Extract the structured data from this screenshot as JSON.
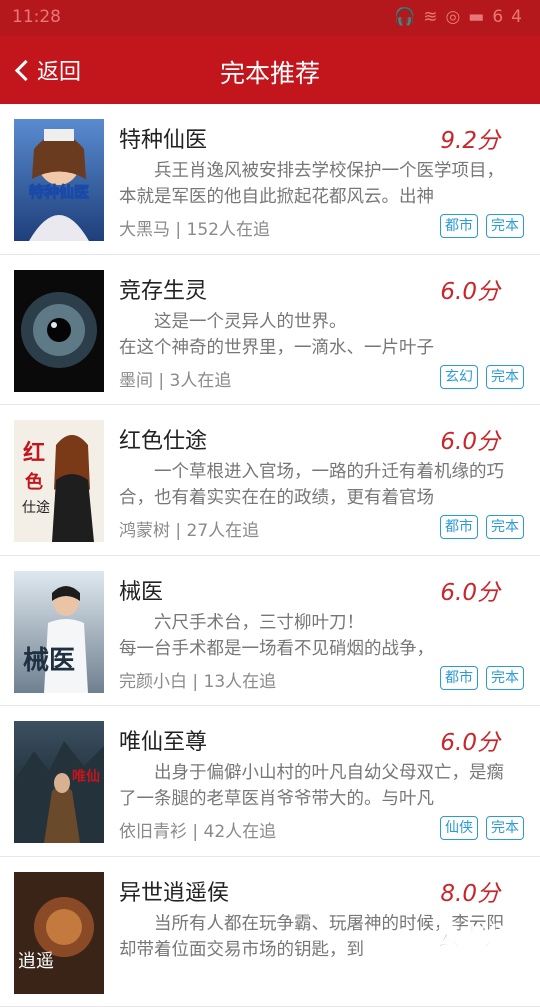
{
  "status_bar": {
    "time": "11:28",
    "icons": [
      "headphones-icon",
      "wifi-icon",
      "sync-icon",
      "battery-icon"
    ],
    "battery": "64"
  },
  "header": {
    "back_label": "返回",
    "title": "完本推荐",
    "accent": "#c3161c"
  },
  "books": [
    {
      "name": "特种仙医",
      "score": "9.2分",
      "desc": "兵王肖逸风被安排去学校保护一个医学项目，本就是军医的他自此掀起花都风云。出神",
      "author": "大黑马",
      "follow": "152人在追",
      "tags": [
        "都市",
        "完本"
      ],
      "cover_text": "特种仙医"
    },
    {
      "name": "竞存生灵",
      "score": "6.0分",
      "desc": "这是一个灵异人的世界。\n在这个神奇的世界里，一滴水、一片叶子",
      "author": "墨间",
      "follow": "3人在追",
      "tags": [
        "玄幻",
        "完本"
      ],
      "cover_text": ""
    },
    {
      "name": "红色仕途",
      "score": "6.0分",
      "desc": "一个草根进入官场，一路的升迁有着机缘的巧合，也有着实实在在的政绩，更有着官场",
      "author": "鸿蒙树",
      "follow": "27人在追",
      "tags": [
        "都市",
        "完本"
      ],
      "cover_text": "红色仕途"
    },
    {
      "name": "械医",
      "score": "6.0分",
      "desc": "六尺手术台，三寸柳叶刀！\n每一台手术都是一场看不见硝烟的战争，",
      "author": "完颜小白",
      "follow": "13人在追",
      "tags": [
        "都市",
        "完本"
      ],
      "cover_text": "械医"
    },
    {
      "name": "唯仙至尊",
      "score": "6.0分",
      "desc": "出身于偏僻小山村的叶凡自幼父母双亡，是瘸了一条腿的老草医肖爷爷带大的。与叶凡",
      "author": "依旧青衫",
      "follow": "42人在追",
      "tags": [
        "仙侠",
        "完本"
      ],
      "cover_text": "唯仙至尊"
    },
    {
      "name": "异世逍遥侯",
      "score": "8.0分",
      "desc": "当所有人都在玩争霸、玩屠神的时候，李云阳却带着位面交易市场的钥匙，到",
      "author": "",
      "follow": "",
      "tags": [],
      "cover_text": "逍遥"
    }
  ],
  "watermark": "云南龙网"
}
